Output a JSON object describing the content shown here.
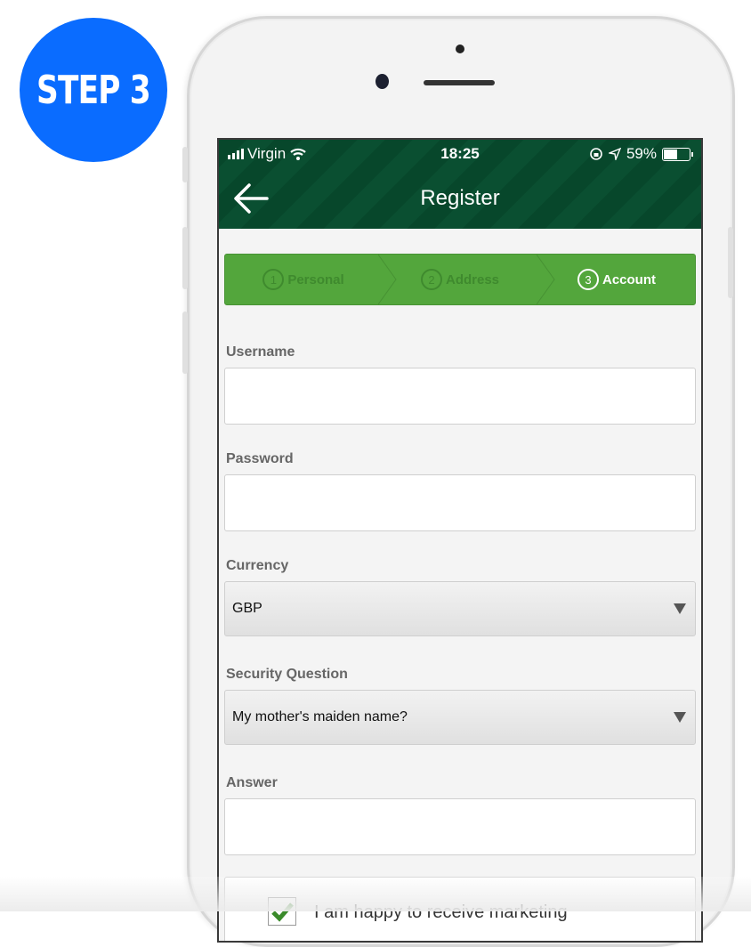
{
  "badge": {
    "text": "STEP 3",
    "color": "#0a6cff"
  },
  "status_bar": {
    "carrier": "Virgin",
    "time": "18:25",
    "battery": "59%",
    "battery_level": 0.59
  },
  "header": {
    "title": "Register",
    "back_icon": "arrow-left-icon"
  },
  "steps": [
    {
      "number": "1",
      "label": "Personal",
      "active": false
    },
    {
      "number": "2",
      "label": "Address",
      "active": false
    },
    {
      "number": "3",
      "label": "Account",
      "active": true
    }
  ],
  "form": {
    "username": {
      "label": "Username",
      "value": ""
    },
    "password": {
      "label": "Password",
      "value": ""
    },
    "currency": {
      "label": "Currency",
      "value": "GBP"
    },
    "security_question": {
      "label": "Security Question",
      "value": "My mother's maiden name?"
    },
    "answer": {
      "label": "Answer",
      "value": ""
    },
    "marketing": {
      "label": "I am happy to receive marketing",
      "checked": true
    }
  },
  "colors": {
    "header": "#07472b",
    "steps": "#53a63c",
    "check": "#3a8a2a"
  }
}
